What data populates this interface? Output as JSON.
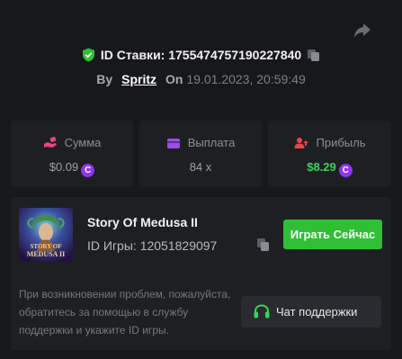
{
  "bet": {
    "id_label": "ID Ставки:",
    "id_value": "1755474757190227840"
  },
  "byline": {
    "by_label": "By",
    "username": "Spritz",
    "on_label": "On",
    "datetime": "19.01.2023, 20:59:49"
  },
  "stats": {
    "amount": {
      "label": "Сумма",
      "value": "$0.09"
    },
    "payout": {
      "label": "Выплата",
      "value": "84 x"
    },
    "profit": {
      "label": "Прибыль",
      "value": "$8.29"
    }
  },
  "coin_symbol": "C",
  "game": {
    "title": "Story Of Medusa II",
    "id_label": "ID Игры:",
    "id_value": "12051829097",
    "thumb_text_line1": "STORY OF",
    "thumb_text_line2": "MEDUSA II",
    "play_label": "Играть Сейчас"
  },
  "support": {
    "help_text": "При возникновении проблем, пожалуйста, обратитесь за помощью в службу поддержки и укажите ID игры.",
    "button_label": "Чат поддержки"
  },
  "colors": {
    "background": "#17181b",
    "panel": "#1e1f23",
    "accent_green": "#2fbf34",
    "profit_green": "#3ad35a",
    "coin_purple": "#8e36f0",
    "amount_pink": "#e8477a",
    "payout_purple": "#9b4de8",
    "profit_red": "#e84545"
  },
  "icons": {
    "share": "share-arrow-icon",
    "shield": "shield-check-icon",
    "copy": "copy-icon",
    "amount": "hand-money-icon",
    "payout": "wallet-icon",
    "profit": "user-profit-icon",
    "headset": "headset-icon"
  }
}
